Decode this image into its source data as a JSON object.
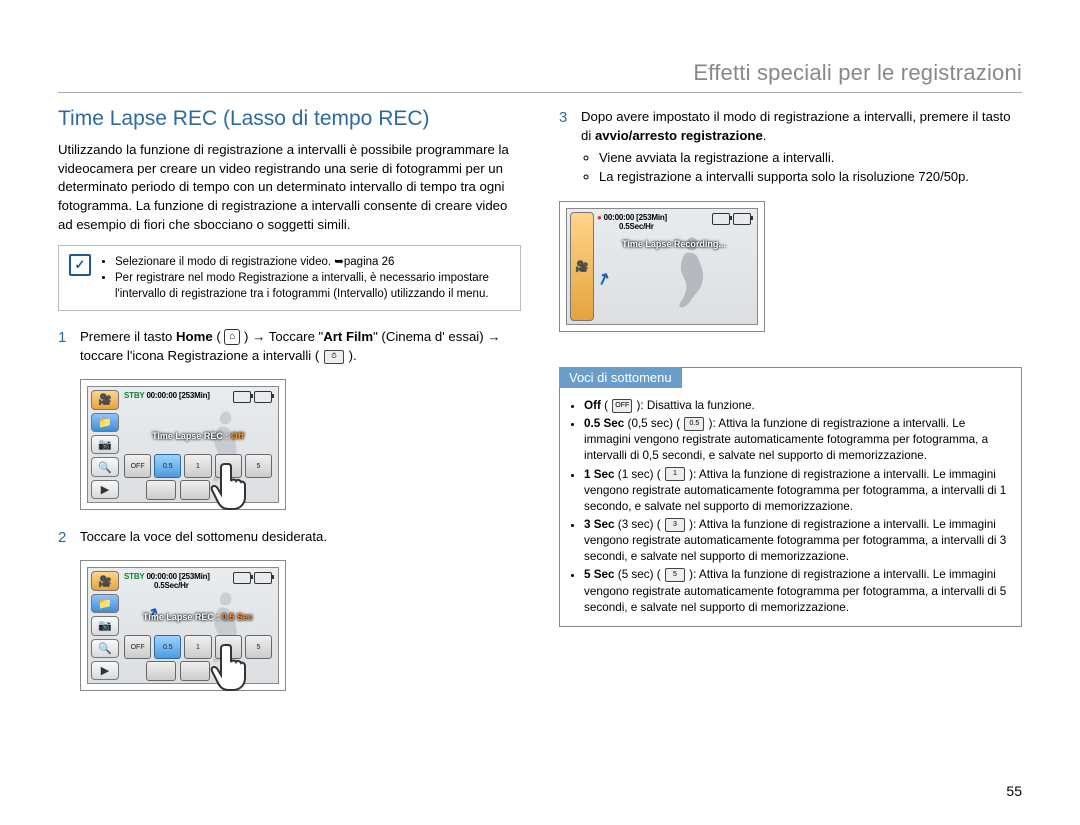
{
  "header": {
    "title": "Effetti speciali per le registrazioni"
  },
  "section": {
    "title": "Time Lapse REC (Lasso di tempo REC)"
  },
  "intro": "Utilizzando la funzione di registrazione a intervalli è possibile programmare la videocamera per creare un video registrando una serie di fotogrammi per un determinato periodo di tempo con un determinato intervallo di tempo tra ogni fotogramma. La funzione di registrazione a intervalli consente di creare video ad esempio di fiori che sbocciano o soggetti simili.",
  "note": {
    "items": [
      "Selezionare il modo di registrazione video. ➥pagina 26",
      "Per registrare nel modo Registrazione a intervalli, è necessario impostare l'intervallo di registrazione tra i fotogrammi (Intervallo) utilizzando il menu."
    ]
  },
  "steps": {
    "s1_pre": "Premere il tasto ",
    "s1_home": "Home",
    "s1_mid": " ( ",
    "s1_mid2": " ) → Toccare \"",
    "s1_art": "Art Film",
    "s1_post": "\" (Cinema d' essai) → toccare l'icona Registrazione a intervalli ( ",
    "s1_end": " ).",
    "s2": "Toccare la voce del sottomenu desiderata.",
    "s3_a": "Dopo avere impostato il modo di registrazione a intervalli, premere il tasto di ",
    "s3_b": "avvio/arresto registrazione",
    "s3_c": ".",
    "s3_bullets": [
      "Viene avviata la registrazione a intervalli.",
      "La registrazione a intervalli supporta solo la risoluzione 720/50p."
    ]
  },
  "lcd1": {
    "status_stby": "STBY",
    "status_time": "00:00:00",
    "status_rem": "[253Min]",
    "overlay_pre": "Time Lapse REC : ",
    "overlay_val": "Off",
    "opts": [
      "OFF",
      "0.5",
      "1",
      "3",
      "5"
    ]
  },
  "lcd2": {
    "status_stby": "STBY",
    "status_time": "00:00:00",
    "status_rem": "[253Min]",
    "sub": "0.5Sec/Hr",
    "overlay_pre": "Time Lapse REC : ",
    "overlay_val": "0.5 Sec",
    "opts": [
      "OFF",
      "0.5",
      "1",
      "3",
      "5"
    ]
  },
  "lcd3": {
    "status_time": "00:00:00",
    "status_rem": "[253Min]",
    "sub": "0.5Sec/Hr",
    "overlay": "Time Lapse Recording..."
  },
  "submenu": {
    "heading": "Voci di sottomenu",
    "off_label": "Off",
    "off_desc": ": Disattiva la funzione.",
    "items": [
      {
        "label": "0.5 Sec",
        "paren": "(0,5 sec)",
        "desc": ": Attiva la funzione di registrazione a intervalli. Le immagini vengono registrate automaticamente fotogramma per fotogramma, a intervalli di 0,5 secondi, e salvate nel supporto di memorizzazione."
      },
      {
        "label": "1 Sec",
        "paren": "(1 sec)",
        "desc": ": Attiva la funzione di registrazione a intervalli. Le immagini vengono registrate automaticamente fotogramma per fotogramma, a intervalli di 1 secondo, e salvate nel supporto di memorizzazione."
      },
      {
        "label": "3 Sec",
        "paren": "(3 sec)",
        "desc": ": Attiva la funzione di registrazione a intervalli. Le immagini vengono registrate automaticamente fotogramma per fotogramma, a intervalli di 3 secondi, e salvate nel supporto di memorizzazione."
      },
      {
        "label": "5 Sec",
        "paren": "(5 sec)",
        "desc": ": Attiva la funzione di registrazione a intervalli. Le immagini vengono registrate automaticamente fotogramma per fotogramma, a intervalli di 5 secondi, e salvate nel supporto di memorizzazione."
      }
    ]
  },
  "page_number": "55"
}
